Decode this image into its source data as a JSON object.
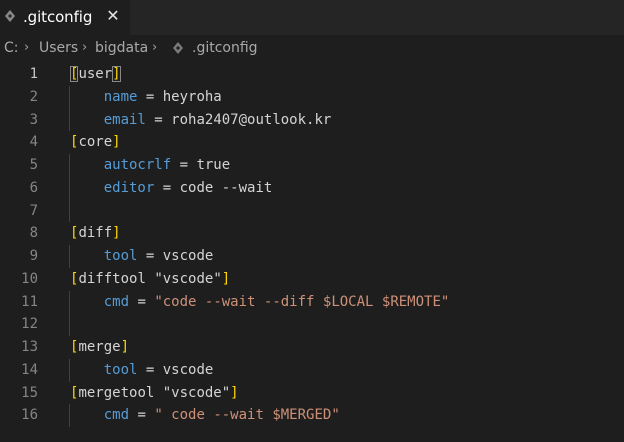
{
  "tab": {
    "filename": ".gitconfig",
    "close_symbol": "✕",
    "icon": "gear-file-icon"
  },
  "breadcrumb": {
    "items": [
      "C:",
      "Users",
      "bigdata",
      ".gitconfig"
    ],
    "separator": "›",
    "file_icon": "gear-file-icon"
  },
  "editor": {
    "active_line": 1,
    "lines": [
      {
        "n": "1",
        "section": "user"
      },
      {
        "n": "2",
        "key": "name",
        "eq": " = ",
        "value": "heyroha"
      },
      {
        "n": "3",
        "key": "email",
        "eq": " = ",
        "value": "roha2407@outlook.kr"
      },
      {
        "n": "4",
        "section": "core"
      },
      {
        "n": "5",
        "key": "autocrlf",
        "eq": " = ",
        "value": "true"
      },
      {
        "n": "6",
        "key": "editor",
        "eq": " = ",
        "value": "code --wait"
      },
      {
        "n": "7"
      },
      {
        "n": "8",
        "section": "diff"
      },
      {
        "n": "9",
        "key": "tool",
        "eq": " = ",
        "value": "vscode"
      },
      {
        "n": "10",
        "section_name": "difftool",
        "section_str": "\"vscode\""
      },
      {
        "n": "11",
        "key": "cmd",
        "eq": " = ",
        "str": "\"code --wait --diff $LOCAL $REMOTE\""
      },
      {
        "n": "12"
      },
      {
        "n": "13",
        "section": "merge"
      },
      {
        "n": "14",
        "key": "tool",
        "eq": " = ",
        "value": "vscode"
      },
      {
        "n": "15",
        "section_name": "mergetool",
        "section_str": "\"vscode\""
      },
      {
        "n": "16",
        "key": "cmd",
        "eq": " = ",
        "str": "\" code --wait $MERGED\""
      }
    ]
  },
  "colors": {
    "background": "#1e1e1e",
    "tabbar": "#252526",
    "bracket": "#ffd700",
    "key": "#569cd6",
    "string": "#ce9178",
    "text": "#d4d4d4",
    "line_number": "#858585"
  }
}
